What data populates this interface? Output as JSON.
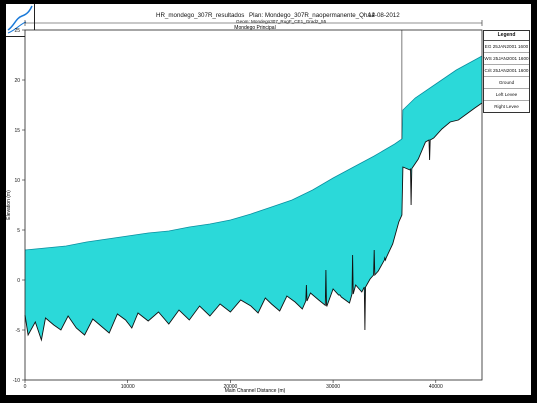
{
  "header": {
    "title_left": "HR_mondego_307R_resultados",
    "plan": "Plan: Mondego_307R_naopermanente_QhA2",
    "date": "14-08-2012",
    "geom": "Geom: Mondego307_RugF_CE1_Grad2_55"
  },
  "legend": {
    "title": "Legend",
    "items": [
      "EG 25JAN2001 1600",
      "WS 25JAN2001 1600",
      "Crit 25JAN2001 1600",
      "Ground",
      "Left Levee",
      "Right Levee"
    ]
  },
  "colors": {
    "water": "#2bd9d9",
    "ground": "#111111",
    "background": "#ffffff",
    "frame": "#000000"
  },
  "chart_data": {
    "type": "area",
    "title": "",
    "xlabel": "Main Channel Distance (m)",
    "ylabel": "Elevation (m)",
    "reach_label": "Mondego Principal",
    "xlim": [
      0,
      44500
    ],
    "ylim": [
      -10,
      25
    ],
    "xticks": [
      0,
      10000,
      20000,
      30000,
      40000
    ],
    "yticks": [
      -10,
      -5,
      0,
      5,
      10,
      15,
      20,
      25
    ],
    "grid": false,
    "legend_position": "right",
    "series": [
      {
        "name": "WS 25JAN2001 1600",
        "x": [
          0,
          2000,
          4000,
          6000,
          8000,
          10000,
          12000,
          14000,
          16000,
          18000,
          20000,
          22000,
          24000,
          26000,
          28000,
          30000,
          32000,
          34000,
          36000,
          36700,
          36800,
          38000,
          40000,
          42000,
          44500
        ],
        "y": [
          3.0,
          3.2,
          3.4,
          3.8,
          4.1,
          4.4,
          4.7,
          4.9,
          5.3,
          5.6,
          6.0,
          6.6,
          7.3,
          8.0,
          9.0,
          10.2,
          11.3,
          12.4,
          13.6,
          14.1,
          17.0,
          18.2,
          19.6,
          21.0,
          22.4
        ]
      },
      {
        "name": "Ground",
        "x": [
          0,
          300,
          1000,
          1600,
          2000,
          2800,
          3500,
          4200,
          5000,
          5800,
          6600,
          7400,
          8200,
          9000,
          9800,
          10400,
          11000,
          12000,
          13000,
          14000,
          15000,
          16000,
          17000,
          18000,
          19000,
          20000,
          21000,
          22000,
          22700,
          23400,
          24000,
          24800,
          25500,
          26300,
          27000,
          27800,
          28600,
          29400,
          30000,
          30800,
          31600,
          32200,
          32800,
          33600,
          34400,
          35000,
          35800,
          36400,
          36700,
          36800,
          37500,
          38300,
          39000,
          39800,
          40600,
          41400,
          42200,
          43000,
          43800,
          44500
        ],
        "y": [
          -3.5,
          -5.5,
          -4.2,
          -6.0,
          -3.8,
          -4.5,
          -5.0,
          -3.6,
          -4.8,
          -5.5,
          -3.9,
          -4.6,
          -5.3,
          -3.4,
          -4.0,
          -4.8,
          -3.3,
          -4.1,
          -3.2,
          -4.4,
          -3.0,
          -4.0,
          -2.6,
          -3.6,
          -2.4,
          -3.2,
          -2.0,
          -2.6,
          -3.3,
          -1.8,
          -2.4,
          -3.1,
          -1.6,
          -2.2,
          -2.9,
          -1.3,
          -2.0,
          -2.6,
          -0.9,
          -1.7,
          -2.3,
          -0.5,
          -1.2,
          0.1,
          0.9,
          2.0,
          3.6,
          5.8,
          6.5,
          11.3,
          11.0,
          12.1,
          13.8,
          14.2,
          15.1,
          15.8,
          16.0,
          16.6,
          17.2,
          17.7
        ]
      }
    ],
    "spikes": [
      {
        "x": 27400,
        "y": -0.5
      },
      {
        "x": 29300,
        "y": 1.0
      },
      {
        "x": 30600,
        "y": -1.5
      },
      {
        "x": 31900,
        "y": 2.5
      },
      {
        "x": 33100,
        "y": -5.0
      },
      {
        "x": 34000,
        "y": 3.0
      },
      {
        "x": 35100,
        "y": 2.0
      },
      {
        "x": 37600,
        "y": 7.5
      },
      {
        "x": 39400,
        "y": 12.0
      }
    ],
    "markers": [
      {
        "x": 36700,
        "label": ""
      }
    ]
  }
}
